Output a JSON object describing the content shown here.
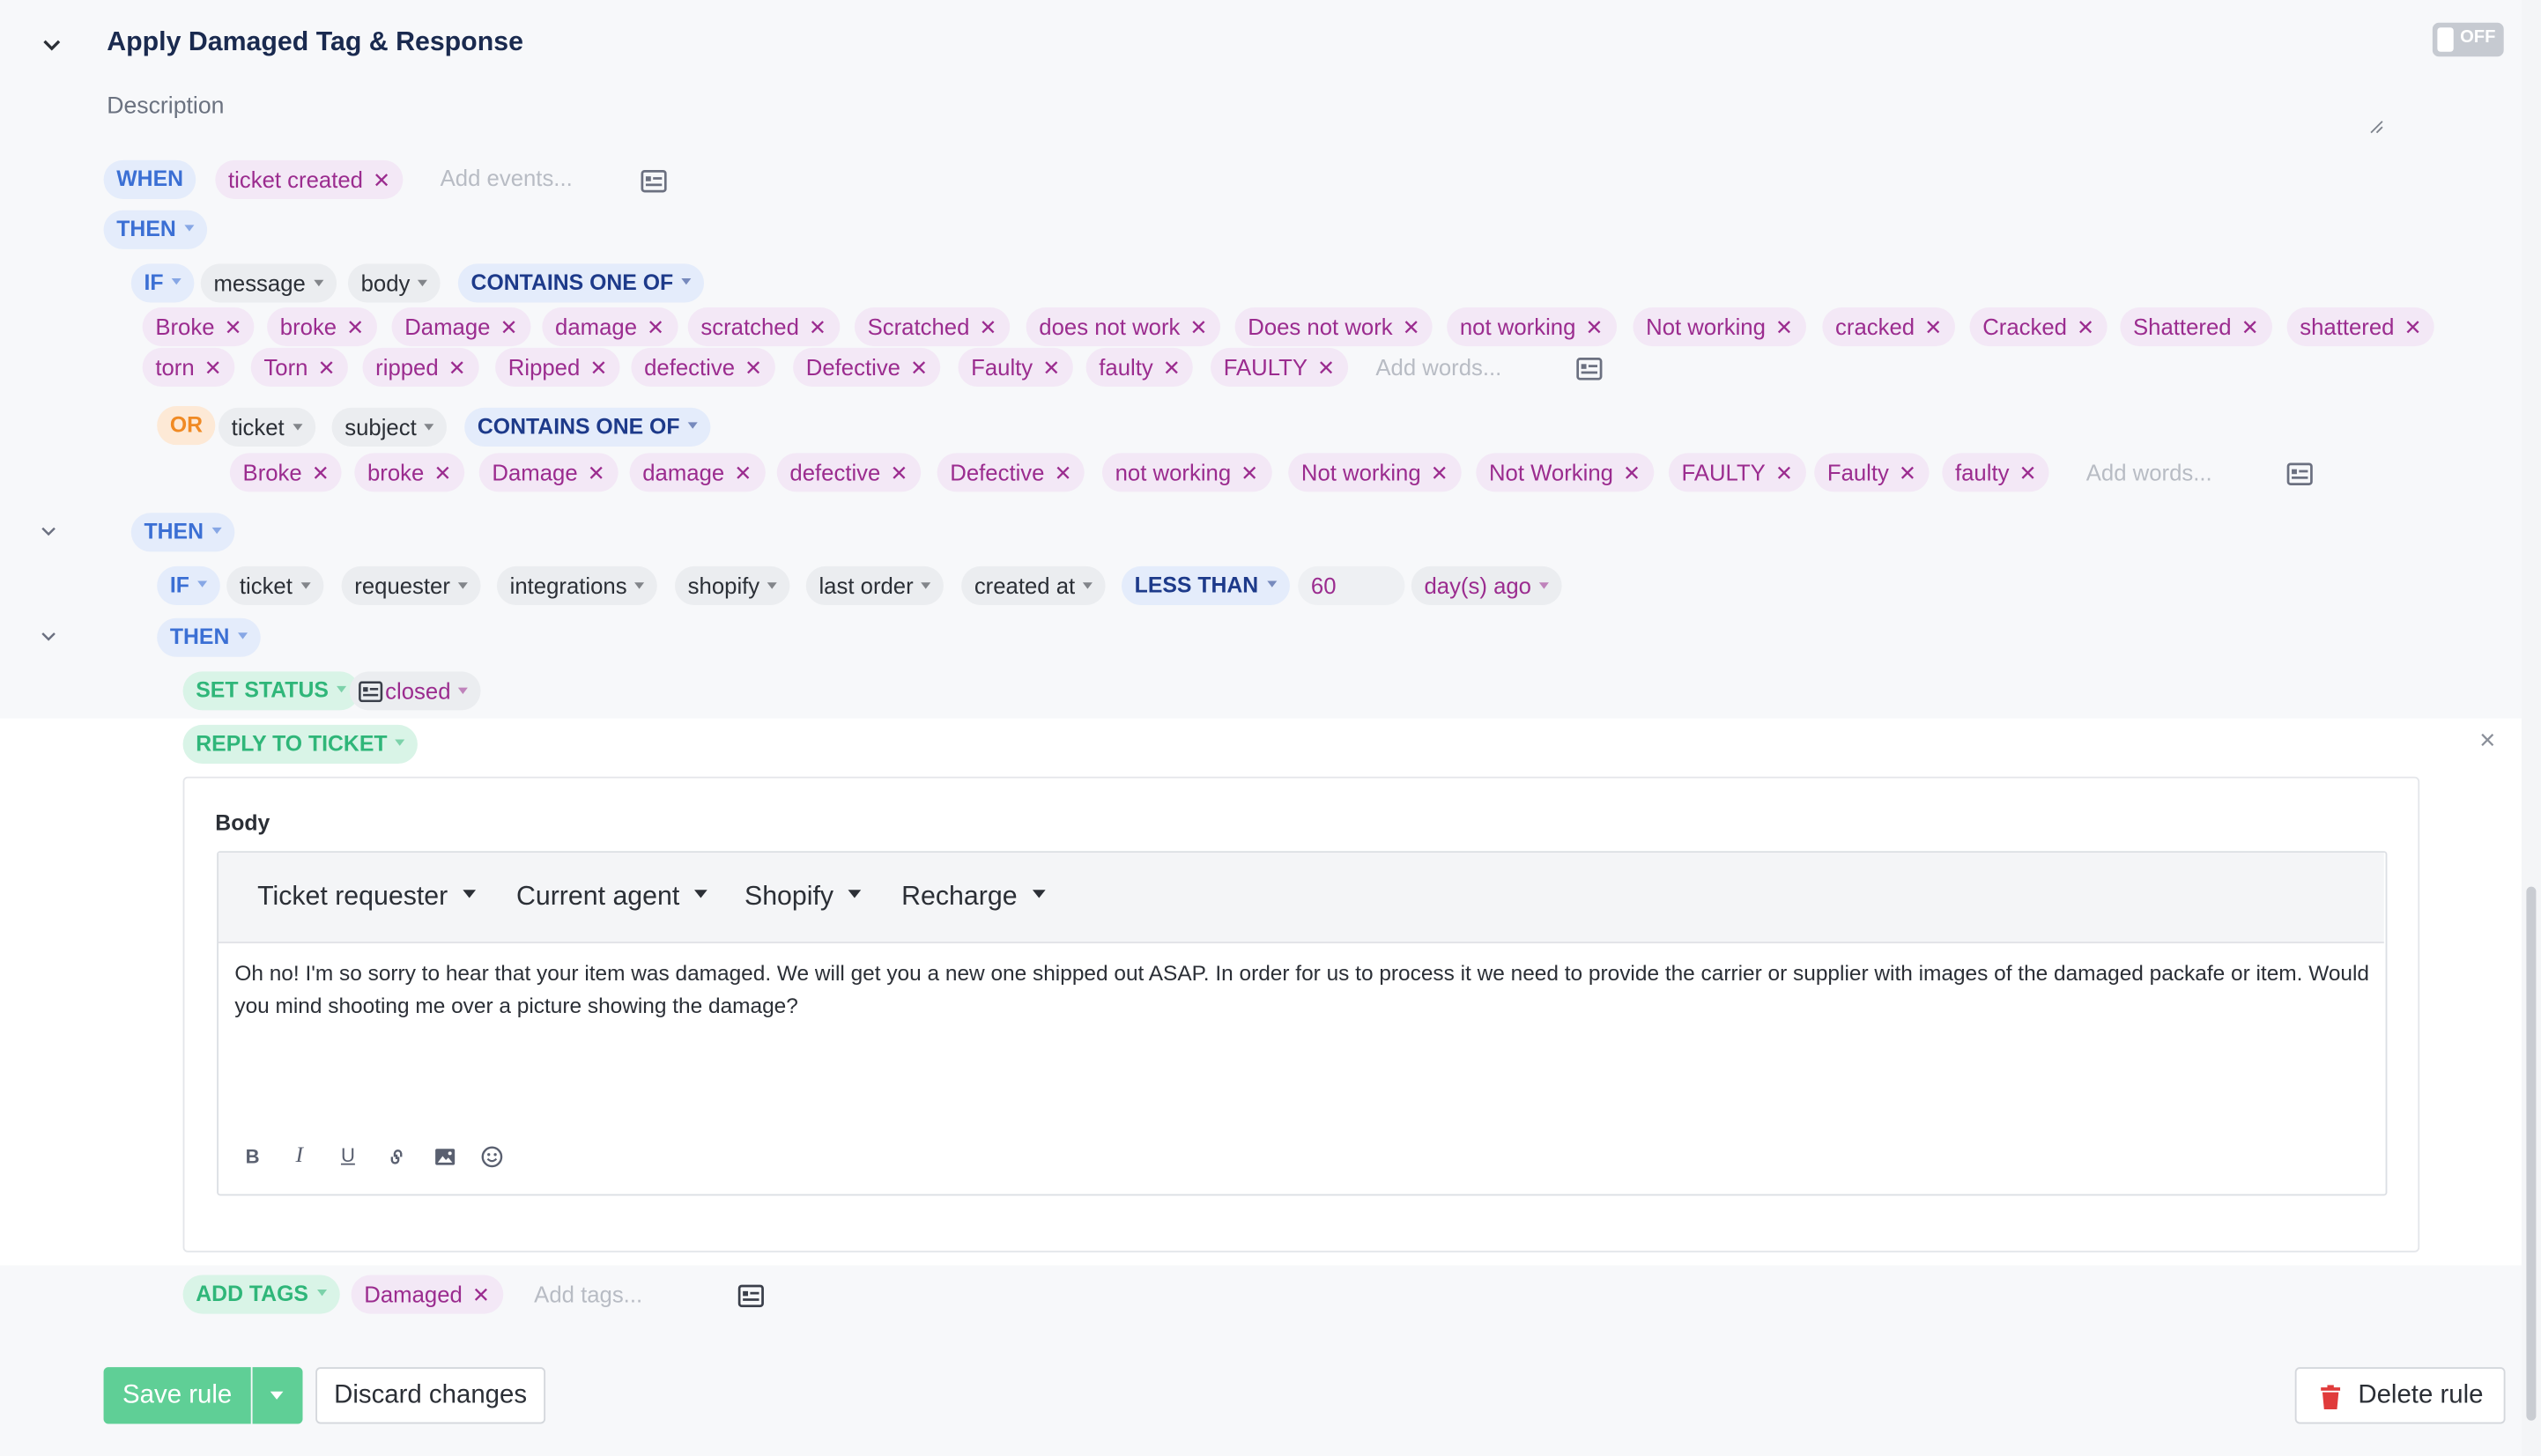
{
  "rule": {
    "title": "Apply Damaged Tag & Response",
    "toggle_label": "OFF",
    "description_placeholder": "Description"
  },
  "when": {
    "keyword": "WHEN",
    "event": "ticket created",
    "events_placeholder": "Add events..."
  },
  "then_keyword": "THEN",
  "if_block": {
    "if_keyword": "IF",
    "field1": "message",
    "field2": "body",
    "operator": "CONTAINS ONE OF",
    "words_row1": [
      "Broke",
      "broke",
      "Damage",
      "damage",
      "scratched",
      "Scratched",
      "does not work",
      "Does not work",
      "not working",
      "Not working",
      "cracked",
      "Cracked",
      "Shattered",
      "shattered"
    ],
    "words_row2": [
      "torn",
      "Torn",
      "ripped",
      "Ripped",
      "defective",
      "Defective",
      "Faulty",
      "faulty",
      "FAULTY"
    ],
    "words_placeholder": "Add words..."
  },
  "or_block": {
    "or_keyword": "OR",
    "field1": "ticket",
    "field2": "subject",
    "operator": "CONTAINS ONE OF",
    "words": [
      "Broke",
      "broke",
      "Damage",
      "damage",
      "defective",
      "Defective",
      "not working",
      "Not working",
      "Not Working",
      "FAULTY",
      "Faulty",
      "faulty"
    ],
    "words_placeholder": "Add words..."
  },
  "then2_keyword": "THEN",
  "if2_block": {
    "if_keyword": "IF",
    "fields": [
      "ticket",
      "requester",
      "integrations",
      "shopify",
      "last order",
      "created at"
    ],
    "operator": "LESS THAN",
    "value": "60",
    "unit": "day(s) ago"
  },
  "then3_keyword": "THEN",
  "set_status": {
    "label": "SET STATUS",
    "value": "closed"
  },
  "reply": {
    "label": "REPLY TO TICKET",
    "close_glyph": "×",
    "body_label": "Body",
    "variables": [
      "Ticket requester",
      "Current agent",
      "Shopify",
      "Recharge"
    ],
    "message": "Oh no! I'm so sorry to hear that your item was damaged. We will get you a new one shipped out ASAP. In order for us to process it we need to provide the carrier or supplier with images of the damaged packafe or item. Would you mind shooting me over a picture showing the damage?",
    "format_tools": [
      "bold-icon",
      "italic-icon",
      "underline-icon",
      "link-icon",
      "image-icon",
      "emoji-icon"
    ]
  },
  "add_tags": {
    "label": "ADD TAGS",
    "tag": "Damaged",
    "placeholder": "Add tags..."
  },
  "footer": {
    "save_label": "Save rule",
    "discard_label": "Discard changes",
    "delete_label": "Delete rule"
  },
  "colors": {
    "accent_blue": "#3b6fd4",
    "action_green": "#2fb679",
    "save_green": "#5fcf96",
    "tag_purple": "#9b2c8f",
    "delete_red": "#e03b3b"
  }
}
